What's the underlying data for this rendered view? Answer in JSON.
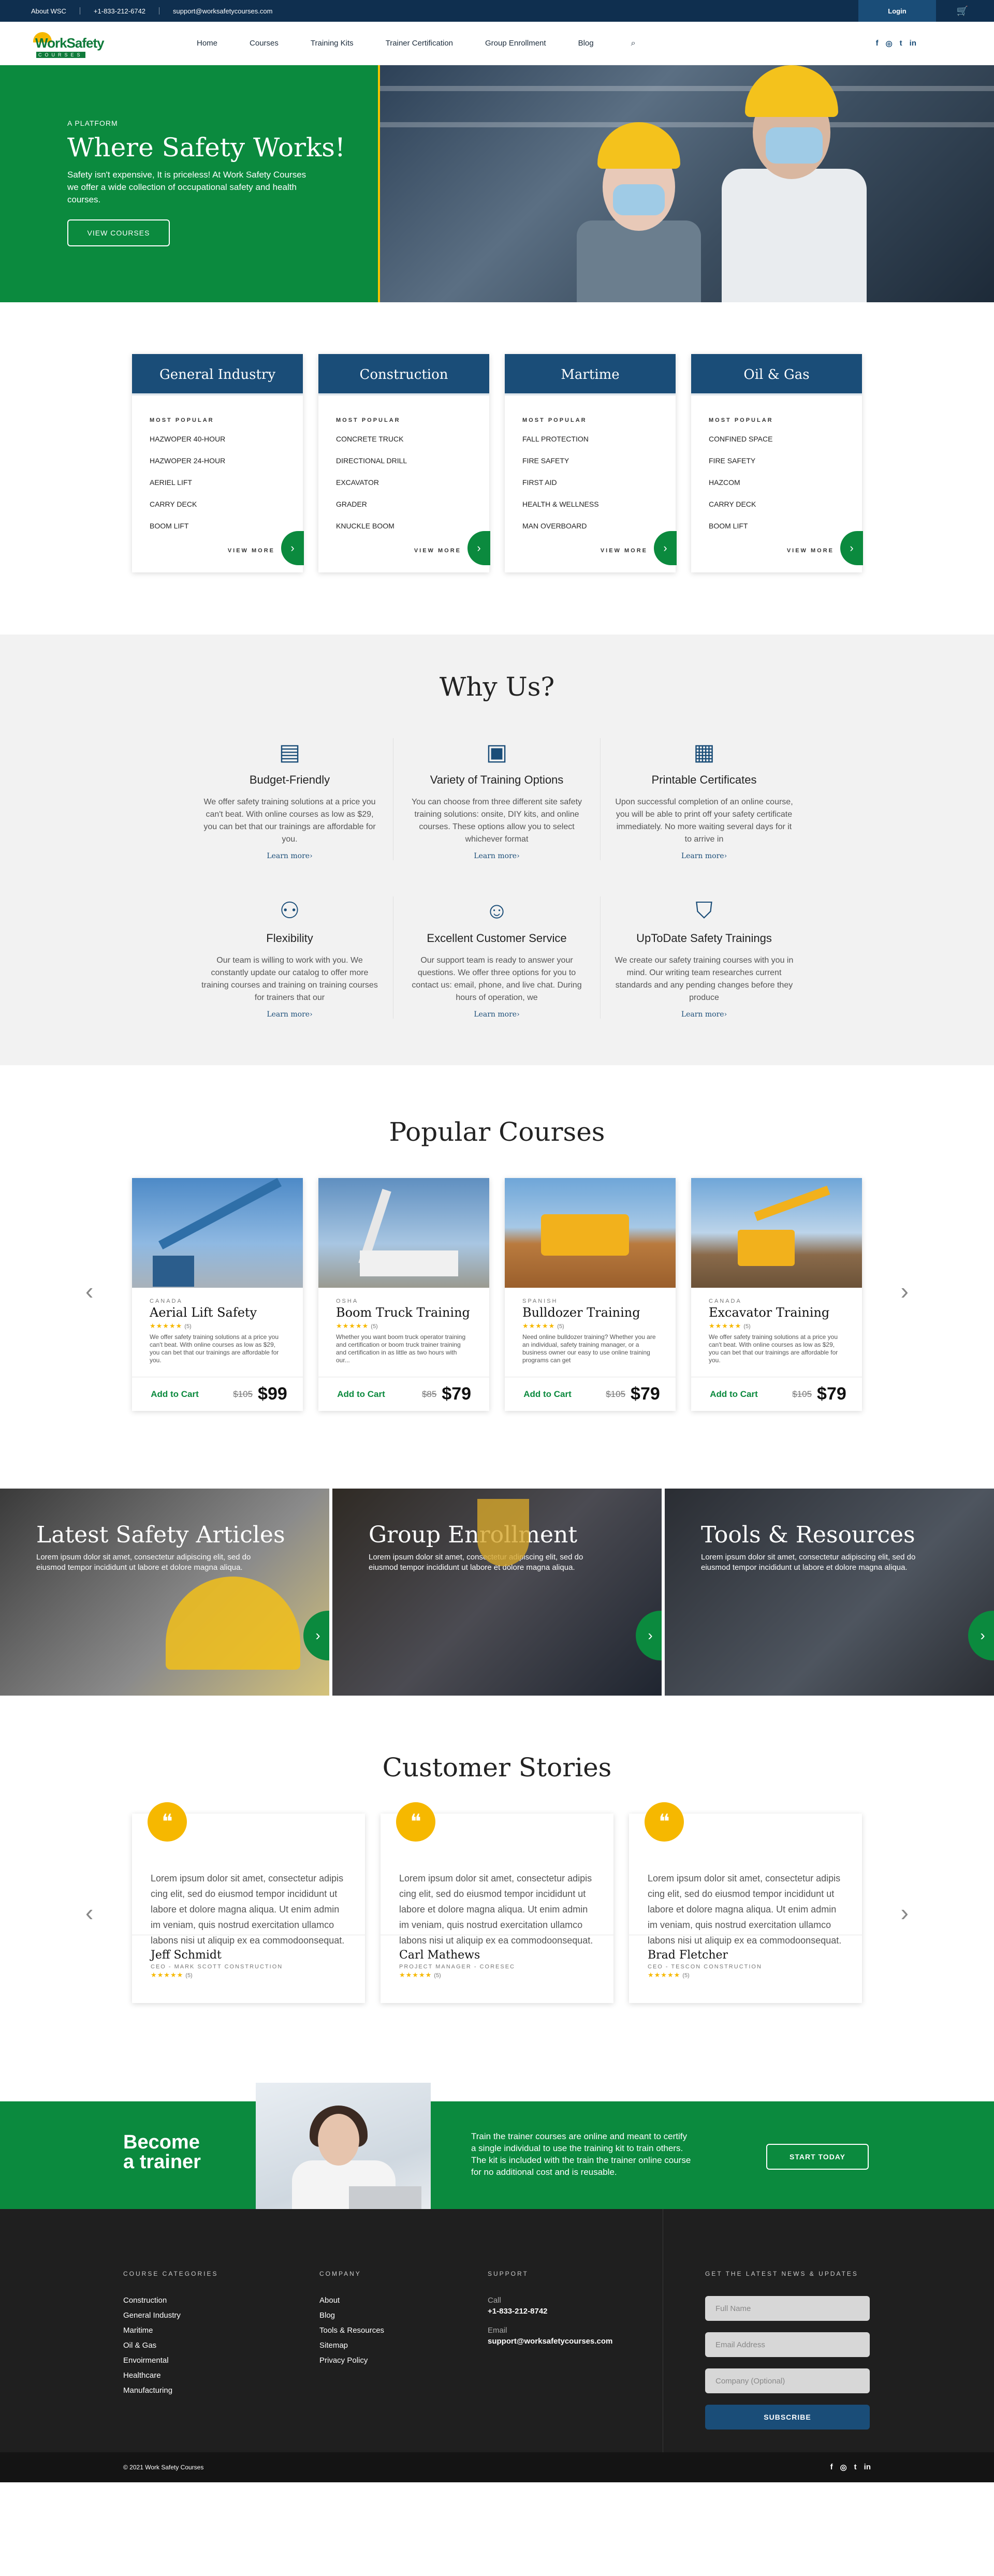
{
  "topbar": {
    "about": "About WSC",
    "phone": "+1-833-212-6742",
    "email": "support@worksafetycourses.com",
    "login": "Login"
  },
  "logo": {
    "line1": "WorkSafety",
    "line2": "COURSES"
  },
  "nav": {
    "items": [
      "Home",
      "Courses",
      "Training Kits",
      "Trainer Certification",
      "Group Enrollment",
      "Blog"
    ]
  },
  "hero": {
    "kicker": "A PLATFORM",
    "title": "Where Safety Works!",
    "text": "Safety isn't expensive, It is priceless! At Work Safety Courses we offer a wide collection of occupational safety and health courses.",
    "button": "VIEW COURSES"
  },
  "categories": [
    {
      "title": "General Industry",
      "label": "MOST POPULAR",
      "courses": [
        "HAZWOPER 40-HOUR",
        "HAZWOPER 24-HOUR",
        "AERIEL LIFT",
        "CARRY DECK",
        "BOOM LIFT"
      ],
      "more": "VIEW MORE"
    },
    {
      "title": "Construction",
      "label": "MOST POPULAR",
      "courses": [
        "CONCRETE TRUCK",
        "DIRECTIONAL DRILL",
        "EXCAVATOR",
        "GRADER",
        "KNUCKLE BOOM"
      ],
      "more": "VIEW MORE"
    },
    {
      "title": "Martime",
      "label": "MOST POPULAR",
      "courses": [
        "FALL PROTECTION",
        "FIRE SAFETY",
        "FIRST AID",
        "HEALTH & WELLNESS",
        "MAN OVERBOARD"
      ],
      "more": "VIEW MORE"
    },
    {
      "title": "Oil & Gas",
      "label": "MOST POPULAR",
      "courses": [
        "CONFINED SPACE",
        "FIRE SAFETY",
        "HAZCOM",
        "CARRY DECK",
        "BOOM LIFT"
      ],
      "more": "VIEW MORE"
    }
  ],
  "why": {
    "title": "Why Us?",
    "items": [
      {
        "title": "Budget-Friendly",
        "text": "We offer safety training solutions at a price you can't beat. With online courses as low as $29, you can bet that our trainings are affordable for you.",
        "link": "Learn more›"
      },
      {
        "title": "Variety of Training Options",
        "text": "You can choose from three different site safety training solutions: onsite, DIY kits, and online courses. These options allow you to select whichever format",
        "link": "Learn more›"
      },
      {
        "title": "Printable Certificates",
        "text": "Upon successful completion of an online course, you will be able to print off your safety certificate immediately. No more waiting several days for it to arrive in",
        "link": "Learn more›"
      },
      {
        "title": "Flexibility",
        "text": "Our team is willing to work with you. We constantly update our catalog to offer more training courses and training on training courses for trainers that our",
        "link": "Learn more›"
      },
      {
        "title": "Excellent Customer Service",
        "text": "Our support team is ready to answer your questions. We offer three options for you to contact us: email, phone, and live chat. During hours of operation, we",
        "link": "Learn more›"
      },
      {
        "title": "UpToDate Safety Trainings",
        "text": "We create our safety training courses with you in mind. Our writing team researches current standards and any pending changes before they produce",
        "link": "Learn more›"
      }
    ]
  },
  "popular": {
    "title": "Popular Courses",
    "courses": [
      {
        "loc": "CANADA",
        "title": "Aerial Lift Safety",
        "stars": "★★★★★",
        "count": "(5)",
        "text": "We offer safety training solutions at a price you can't beat. With online courses as low as $29, you can bet that our trainings are affordable for you.",
        "add": "Add to Cart",
        "old": "$105",
        "price": "$99"
      },
      {
        "loc": "OSHA",
        "title": "Boom Truck Training",
        "stars": "★★★★★",
        "count": "(5)",
        "text": "Whether you want boom truck operator training and certification or boom truck trainer training and certification in as little as two hours with our...",
        "add": "Add to Cart",
        "old": "$85",
        "price": "$79"
      },
      {
        "loc": "SPANISH",
        "title": "Bulldozer Training",
        "stars": "★★★★★",
        "count": "(5)",
        "text": "Need online bulldozer training? Whether you are an individual, safety training manager, or a business owner our easy to use online training programs can get",
        "add": "Add to Cart",
        "old": "$105",
        "price": "$79"
      },
      {
        "loc": "CANADA",
        "title": "Excavator Training",
        "stars": "★★★★★",
        "count": "(5)",
        "text": "We offer safety training solutions at a price you can't beat. With online courses as low as $29, you can bet that our trainings are affordable for you.",
        "add": "Add to Cart",
        "old": "$105",
        "price": "$79"
      }
    ]
  },
  "banners": [
    {
      "title": "Latest Safety Articles",
      "text": "Lorem ipsum dolor sit amet, consectetur adipiscing elit, sed do eiusmod tempor incididunt ut labore et dolore magna aliqua."
    },
    {
      "title": "Group Enrollment",
      "text": "Lorem ipsum dolor sit amet, consectetur adipiscing elit, sed do eiusmod tempor incididunt ut labore et dolore magna aliqua."
    },
    {
      "title": "Tools & Resources",
      "text": "Lorem ipsum dolor sit amet, consectetur adipiscing elit, sed do eiusmod tempor incididunt ut labore et dolore magna aliqua."
    }
  ],
  "stories": {
    "title": "Customer Stories",
    "items": [
      {
        "text": "Lorem ipsum dolor sit amet, consectetur adipis cing elit, sed do eiusmod tempor incididunt ut labore et dolore magna aliqua. Ut enim admin im veniam, quis nostrud exercitation ullamco labons nisi ut aliquip ex ea commodoonsequat.",
        "name": "Jeff Schmidt",
        "role": "CEO - MARK SCOTT CONSTRUCTION",
        "stars": "★★★★★",
        "count": "(5)"
      },
      {
        "text": "Lorem ipsum dolor sit amet, consectetur adipis cing elit, sed do eiusmod tempor incididunt ut labore et dolore magna aliqua. Ut enim admin im veniam, quis nostrud exercitation ullamco labons nisi ut aliquip ex ea commodoonsequat.",
        "name": "Carl Mathews",
        "role": "PROJECT MANAGER - CORESEC",
        "stars": "★★★★★",
        "count": "(5)"
      },
      {
        "text": "Lorem ipsum dolor sit amet, consectetur adipis cing elit, sed do eiusmod tempor incididunt ut labore et dolore magna aliqua. Ut enim admin im veniam, quis nostrud exercitation ullamco labons nisi ut aliquip ex ea commodoonsequat.",
        "name": "Brad Fletcher",
        "role": "CEO - TESCON CONSTRUCTION",
        "stars": "★★★★★",
        "count": "(5)"
      }
    ]
  },
  "cta": {
    "title1": "Become",
    "title2": "a trainer",
    "text": "Train the trainer courses are online and meant to certify a single individual to use the training kit to train others. The kit is included with the train the trainer online course for no additional cost and is reusable.",
    "button": "START TODAY"
  },
  "footer": {
    "categories_title": "COURSE CATEGORIES",
    "categories": [
      "Construction",
      "General Industry",
      "Maritime",
      "Oil & Gas",
      "Envoirmental",
      "Healthcare",
      "Manufacturing"
    ],
    "company_title": "COMPANY",
    "company": [
      "About",
      "Blog",
      "Tools & Resources",
      "Sitemap",
      "Privacy Policy"
    ],
    "support_title": "SUPPORT",
    "call_label": "Call",
    "phone": "+1-833-212-8742",
    "email_label": "Email",
    "email": "support@worksafetycourses.com",
    "news_title": "GET THE LATEST NEWS & UPDATES",
    "fullname": "Full Name",
    "email_ph": "Email Address",
    "company_ph": "Company (Optional)",
    "subscribe": "SUBSCRIBE",
    "copyright": "© 2021 Work Safety Courses"
  },
  "colors": {
    "navy": "#1a4d78",
    "green": "#0b8a3e",
    "yellow": "#f6b800",
    "dark": "#1f1f1f"
  },
  "icons": [
    "search-icon",
    "cart-icon",
    "facebook-icon",
    "instagram-icon",
    "twitter-icon",
    "linkedin-icon",
    "chevron-right-icon",
    "chevron-left-icon",
    "quote-icon"
  ]
}
